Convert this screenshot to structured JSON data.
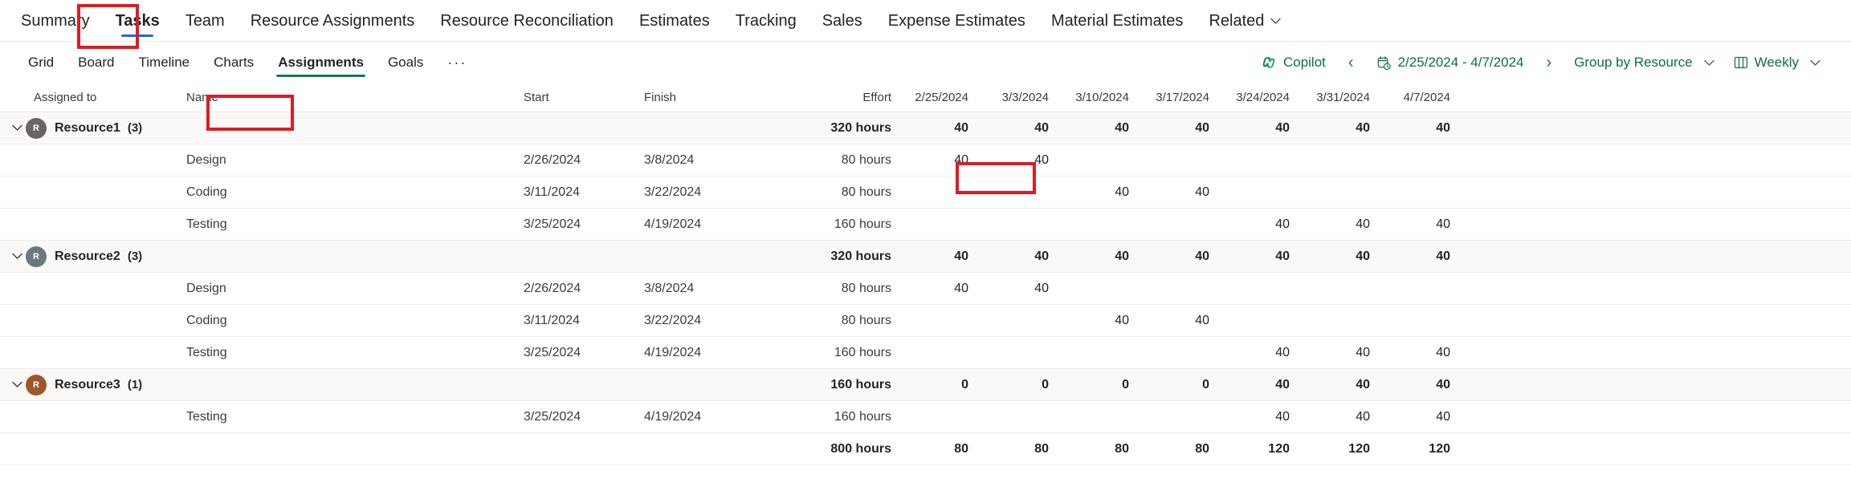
{
  "topnav": {
    "items": [
      {
        "label": "Summary",
        "selected": false
      },
      {
        "label": "Tasks",
        "selected": true
      },
      {
        "label": "Team",
        "selected": false
      },
      {
        "label": "Resource Assignments",
        "selected": false
      },
      {
        "label": "Resource Reconciliation",
        "selected": false
      },
      {
        "label": "Estimates",
        "selected": false
      },
      {
        "label": "Tracking",
        "selected": false
      },
      {
        "label": "Sales",
        "selected": false
      },
      {
        "label": "Expense Estimates",
        "selected": false
      },
      {
        "label": "Material Estimates",
        "selected": false
      },
      {
        "label": "Related",
        "selected": false,
        "chevron": "chevron-down-icon"
      }
    ],
    "selected_accent": "#2266dd"
  },
  "subbar": {
    "tabs": [
      {
        "label": "Grid",
        "selected": false
      },
      {
        "label": "Board",
        "selected": false
      },
      {
        "label": "Timeline",
        "selected": false
      },
      {
        "label": "Charts",
        "selected": false
      },
      {
        "label": "Assignments",
        "selected": true
      },
      {
        "label": "Goals",
        "selected": false
      }
    ],
    "overflow_label": "···",
    "selected_accent": "#0f7b5f",
    "copilot_label": "Copilot",
    "prev_label": "‹",
    "next_label": "›",
    "date_range": "2/25/2024 - 4/7/2024",
    "group_by_label": "Group by Resource",
    "view_label": "Weekly",
    "chevron": "⌄"
  },
  "table": {
    "columns": {
      "assigned_to": "Assigned to",
      "name": "Name",
      "start": "Start",
      "finish": "Finish",
      "effort": "Effort"
    },
    "week_columns": [
      "2/25/2024",
      "3/3/2024",
      "3/10/2024",
      "3/17/2024",
      "3/24/2024",
      "3/31/2024",
      "4/7/2024"
    ],
    "groups": [
      {
        "avatar_initial": "R",
        "avatar_color": "#6b6462",
        "name": "Resource1",
        "count": "(3)",
        "effort": "320 hours",
        "weeks": [
          "40",
          "40",
          "40",
          "40",
          "40",
          "40",
          "40"
        ],
        "tasks": [
          {
            "name": "Design",
            "start": "2/26/2024",
            "finish": "3/8/2024",
            "effort": "80 hours",
            "weeks": [
              "40",
              "40",
              "",
              "",
              "",
              "",
              ""
            ]
          },
          {
            "name": "Coding",
            "start": "3/11/2024",
            "finish": "3/22/2024",
            "effort": "80 hours",
            "weeks": [
              "",
              "",
              "40",
              "40",
              "",
              "",
              ""
            ]
          },
          {
            "name": "Testing",
            "start": "3/25/2024",
            "finish": "4/19/2024",
            "effort": "160 hours",
            "weeks": [
              "",
              "",
              "",
              "",
              "40",
              "40",
              "40"
            ]
          }
        ]
      },
      {
        "avatar_initial": "R",
        "avatar_color": "#69797e",
        "name": "Resource2",
        "count": "(3)",
        "effort": "320 hours",
        "weeks": [
          "40",
          "40",
          "40",
          "40",
          "40",
          "40",
          "40"
        ],
        "tasks": [
          {
            "name": "Design",
            "start": "2/26/2024",
            "finish": "3/8/2024",
            "effort": "80 hours",
            "weeks": [
              "40",
              "40",
              "",
              "",
              "",
              "",
              ""
            ]
          },
          {
            "name": "Coding",
            "start": "3/11/2024",
            "finish": "3/22/2024",
            "effort": "80 hours",
            "weeks": [
              "",
              "",
              "40",
              "40",
              "",
              "",
              ""
            ]
          },
          {
            "name": "Testing",
            "start": "3/25/2024",
            "finish": "4/19/2024",
            "effort": "160 hours",
            "weeks": [
              "",
              "",
              "",
              "",
              "40",
              "40",
              "40"
            ]
          }
        ]
      },
      {
        "avatar_initial": "R",
        "avatar_color": "#a0562a",
        "name": "Resource3",
        "count": "(1)",
        "effort": "160 hours",
        "weeks": [
          "0",
          "0",
          "0",
          "0",
          "40",
          "40",
          "40"
        ],
        "tasks": [
          {
            "name": "Testing",
            "start": "3/25/2024",
            "finish": "4/19/2024",
            "effort": "160 hours",
            "weeks": [
              "",
              "",
              "",
              "",
              "40",
              "40",
              "40"
            ]
          }
        ]
      }
    ],
    "total_row": {
      "effort": "800 hours",
      "weeks": [
        "80",
        "80",
        "80",
        "80",
        "120",
        "120",
        "120"
      ]
    }
  },
  "highlights": {
    "box_color": "#e01b24",
    "targets": [
      "tab-tasks",
      "subtab-assignments",
      "cell-resource1-design-week2"
    ]
  }
}
